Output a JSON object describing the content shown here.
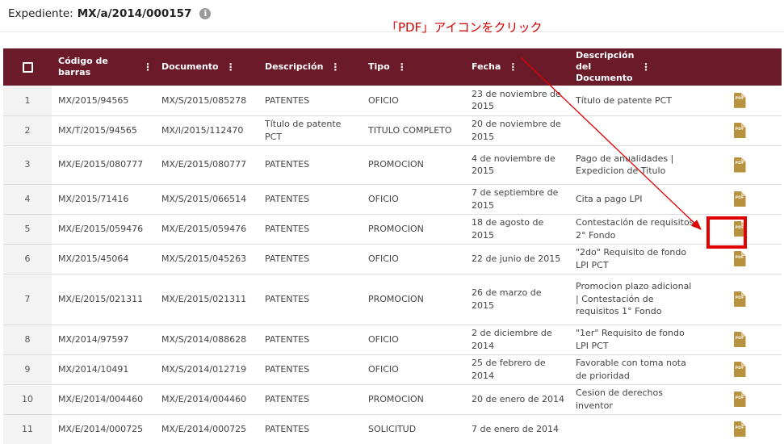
{
  "header": {
    "label": "Expediente:",
    "value": "MX/a/2014/000157",
    "info_icon": "info-icon"
  },
  "annotation": {
    "text": "「PDF」アイコンをクリック",
    "color": "#d40000"
  },
  "colors": {
    "header_bg": "#6b1a2a",
    "pdf_icon": "#b8923f",
    "highlight": "#e00000"
  },
  "table": {
    "columns": [
      {
        "label": "Código de barras"
      },
      {
        "label": "Documento"
      },
      {
        "label": "Descripción"
      },
      {
        "label": "Tipo"
      },
      {
        "label": "Fecha"
      },
      {
        "label": "Descripción del Documento"
      }
    ],
    "pdf_label": "PDF",
    "rows": [
      {
        "n": "1",
        "code": "MX/2015/94565",
        "doc": "MX/S/2015/085278",
        "desc": "PATENTES",
        "tipo": "OFICIO",
        "fecha": "23 de noviembre de 2015",
        "ddesc": "Título de patente PCT"
      },
      {
        "n": "2",
        "code": "MX/T/2015/94565",
        "doc": "MX/I/2015/112470",
        "desc": "Título de patente PCT",
        "tipo": "TITULO COMPLETO",
        "fecha": "20 de noviembre de 2015",
        "ddesc": ""
      },
      {
        "n": "3",
        "code": "MX/E/2015/080777",
        "doc": "MX/E/2015/080777",
        "desc": "PATENTES",
        "tipo": "PROMOCION",
        "fecha": "4 de noviembre de 2015",
        "ddesc": "Pago de anualidades | Expedicion de Titulo"
      },
      {
        "n": "4",
        "code": "MX/2015/71416",
        "doc": "MX/S/2015/066514",
        "desc": "PATENTES",
        "tipo": "OFICIO",
        "fecha": "7 de septiembre de 2015",
        "ddesc": "Cita a pago LPI"
      },
      {
        "n": "5",
        "code": "MX/E/2015/059476",
        "doc": "MX/E/2015/059476",
        "desc": "PATENTES",
        "tipo": "PROMOCION",
        "fecha": "18 de agosto de 2015",
        "ddesc": "Contestación de requisitos 2° Fondo"
      },
      {
        "n": "6",
        "code": "MX/2015/45064",
        "doc": "MX/S/2015/045263",
        "desc": "PATENTES",
        "tipo": "OFICIO",
        "fecha": "22 de junio de 2015",
        "ddesc": "\"2do\" Requisito de fondo LPI PCT"
      },
      {
        "n": "7",
        "code": "MX/E/2015/021311",
        "doc": "MX/E/2015/021311",
        "desc": "PATENTES",
        "tipo": "PROMOCION",
        "fecha": "26 de marzo de 2015",
        "ddesc": "Promocion plazo adicional | Contestación de requisitos 1° Fondo"
      },
      {
        "n": "8",
        "code": "MX/2014/97597",
        "doc": "MX/S/2014/088628",
        "desc": "PATENTES",
        "tipo": "OFICIO",
        "fecha": "2 de diciembre de 2014",
        "ddesc": "\"1er\" Requisito de fondo LPI PCT"
      },
      {
        "n": "9",
        "code": "MX/2014/10491",
        "doc": "MX/S/2014/012719",
        "desc": "PATENTES",
        "tipo": "OFICIO",
        "fecha": "25 de febrero de 2014",
        "ddesc": "Favorable con toma nota de prioridad"
      },
      {
        "n": "10",
        "code": "MX/E/2014/004460",
        "doc": "MX/E/2014/004460",
        "desc": "PATENTES",
        "tipo": "PROMOCION",
        "fecha": "20 de enero de 2014",
        "ddesc": "Cesion de derechos inventor"
      },
      {
        "n": "11",
        "code": "MX/E/2014/000725",
        "doc": "MX/E/2014/000725",
        "desc": "PATENTES",
        "tipo": "SOLICITUD",
        "fecha": "7 de enero de 2014",
        "ddesc": ""
      }
    ]
  }
}
